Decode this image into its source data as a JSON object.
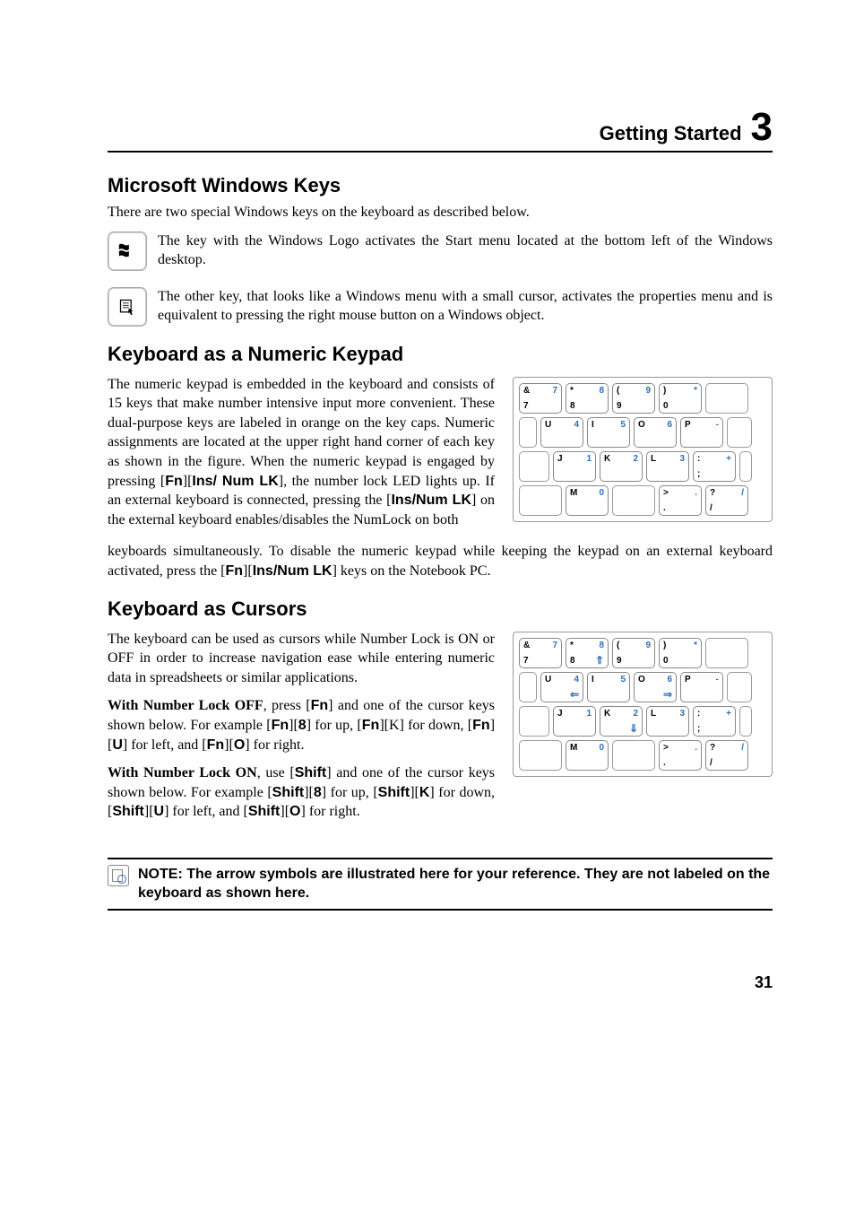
{
  "chapter": {
    "title": "Getting Started",
    "number": "3"
  },
  "section1": {
    "heading": "Microsoft Windows Keys",
    "intro": "There are two special Windows keys on the keyboard as described below.",
    "logo_key_text": "The key with the Windows Logo activates the Start menu located at the bottom left of the Windows desktop.",
    "menu_key_text": "The other key, that looks like a Windows menu with a small cursor, activates the properties menu and is equivalent to pressing the right mouse button on a Windows object."
  },
  "section2": {
    "heading": "Keyboard as a Numeric Keypad",
    "para1_a": "The numeric keypad is embedded in the keyboard and consists of 15 keys that make number intensive input more convenient. These dual-purpose keys are labeled in orange on the key caps. Numeric assignments are located at the upper right hand corner of each key as shown in the figure. When the numeric keypad is engaged by pressing [",
    "fn": "Fn",
    "para1_b": "][",
    "ins1": "Ins/ Num LK",
    "para1_c": "], the number lock LED lights up. If an external keyboard is connected, pressing the [",
    "ins2": "Ins/Num LK",
    "para1_d": "] on the external keyboard enables/disables the NumLock on both",
    "para2_a": "keyboards simultaneously. To disable the numeric keypad while keeping the keypad on an external keyboard activated, press the  [",
    "para2_b": "][",
    "para2_c": "] keys on the Notebook PC."
  },
  "section3": {
    "heading": "Keyboard as Cursors",
    "intro": "The keyboard can be used as cursors while Number Lock is ON or OFF in order to increase navigation ease while entering numeric data in spreadsheets or similar applications.",
    "off_a": "With Number Lock OFF",
    "off_b": ", press [",
    "fn": "Fn",
    "off_c": "] and one of the cursor keys shown below. For example [",
    "off_d": "][",
    "eight": "8",
    "off_e": "] for up, [",
    "off_f": "][K] for down, [",
    "off_g": "][",
    "u": "U",
    "off_h": "] for left, and [",
    "off_i": "][",
    "o": "O",
    "off_j": "] for right.",
    "on_a": "With Number Lock ON",
    "on_b": ", use [",
    "shift": "Shift",
    "on_c": "] and one of the cursor keys shown below. For example [",
    "on_d": "][",
    "on_e": "] for up, [",
    "on_f": "][",
    "k": "K",
    "on_g": "] for down, [",
    "on_h": "][",
    "on_i": "] for left, and [",
    "on_j": "][",
    "on_k": "] for right."
  },
  "note": "NOTE: The arrow symbols are illustrated here for your reference. They are not labeled on the keyboard as shown here.",
  "page_number": "31",
  "keypad1": {
    "r1": [
      {
        "tl": "&",
        "tr": "7",
        "bl": "7"
      },
      {
        "tl": "*",
        "tr": "8",
        "bl": "8"
      },
      {
        "tl": "(",
        "tr": "9",
        "bl": "9"
      },
      {
        "tl": ")",
        "tr": "*",
        "bl": "0"
      }
    ],
    "r2": [
      {
        "tl": "U",
        "tr": "4"
      },
      {
        "tl": "I",
        "tr": "5"
      },
      {
        "tl": "O",
        "tr": "6"
      },
      {
        "tl": "P",
        "tr": "-"
      }
    ],
    "r3": [
      {
        "tl": "J",
        "tr": "1"
      },
      {
        "tl": "K",
        "tr": "2"
      },
      {
        "tl": "L",
        "tr": "3"
      },
      {
        "tl": ":",
        "tr": "+",
        "bl": ";"
      }
    ],
    "r4": [
      {
        "tl": "M",
        "tr": "0"
      },
      {
        "tl": ">",
        "tr": ".",
        "bl": "."
      },
      {
        "tl": "?",
        "tr": "/",
        "bl": "/"
      }
    ]
  },
  "keypad2": {
    "r1": [
      {
        "tl": "&",
        "tr": "7",
        "bl": "7"
      },
      {
        "tl": "*",
        "tr": "8",
        "bl": "8",
        "br": "⇑"
      },
      {
        "tl": "(",
        "tr": "9",
        "bl": "9"
      },
      {
        "tl": ")",
        "tr": "*",
        "bl": "0"
      }
    ],
    "r2": [
      {
        "tl": "U",
        "tr": "4",
        "br": "⇐"
      },
      {
        "tl": "I",
        "tr": "5"
      },
      {
        "tl": "O",
        "tr": "6",
        "br": "⇒"
      },
      {
        "tl": "P",
        "tr": "-"
      }
    ],
    "r3": [
      {
        "tl": "J",
        "tr": "1"
      },
      {
        "tl": "K",
        "tr": "2",
        "br": "⇓"
      },
      {
        "tl": "L",
        "tr": "3"
      },
      {
        "tl": ":",
        "tr": "+",
        "bl": ";"
      }
    ],
    "r4": [
      {
        "tl": "M",
        "tr": "0"
      },
      {
        "tl": ">",
        "tr": ".",
        "bl": "."
      },
      {
        "tl": "?",
        "tr": "/",
        "bl": "/"
      }
    ]
  }
}
